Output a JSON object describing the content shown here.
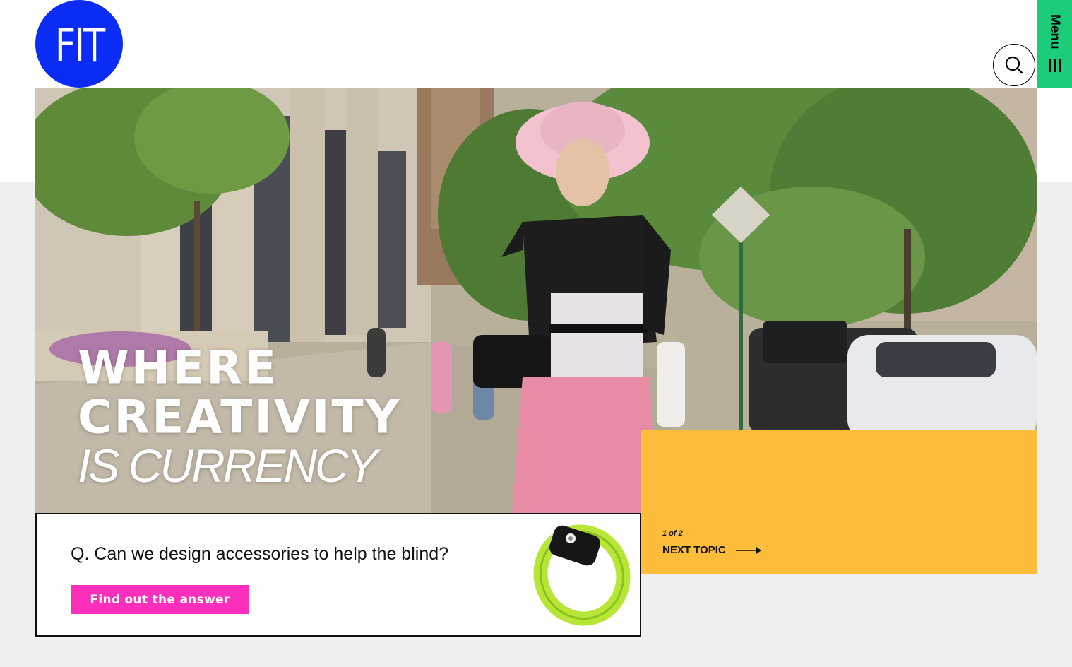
{
  "brand": {
    "logo_text": "FIT",
    "accent": "#0b2cf5"
  },
  "header": {
    "search_icon": "search-icon",
    "menu_label": "Menu",
    "menu_icon": "hamburger-icon",
    "menu_color": "#1ccc7a"
  },
  "hero": {
    "line1": "WHERE",
    "line2": "CREATIVITY",
    "line3": "IS CURRENCY"
  },
  "carousel": {
    "pager": "1 of 2",
    "next_label": "NEXT TOPIC",
    "arrow_icon": "arrow-right-icon",
    "panel_color": "#fdbd3a"
  },
  "feature": {
    "question": "Q. Can we design accessories to help the blind?",
    "cta_label": "Find out the answer",
    "cta_color": "#fc2fbd",
    "image_icon": "wristband-image"
  }
}
